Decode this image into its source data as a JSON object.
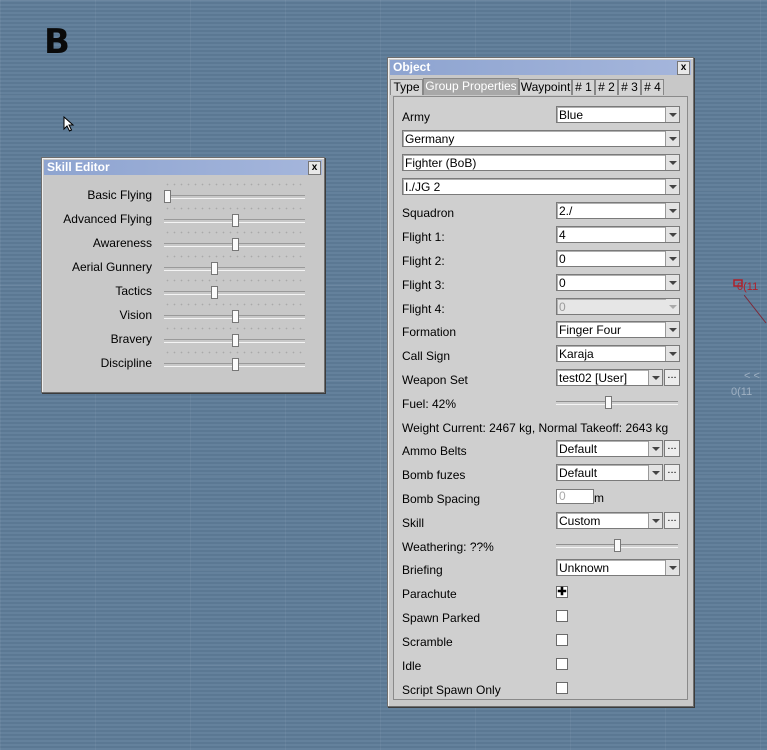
{
  "panel_letter": "B",
  "map": {
    "marker_red": "0(11",
    "marker_faint_1": "< <",
    "marker_faint_2": "0(11"
  },
  "skill_editor": {
    "title": "Skill Editor",
    "close_label": "x",
    "skills": [
      {
        "label": "Basic Flying",
        "level": 0.0
      },
      {
        "label": "Advanced Flying",
        "level": 0.5
      },
      {
        "label": "Awareness",
        "level": 0.5
      },
      {
        "label": "Aerial Gunnery",
        "level": 0.35
      },
      {
        "label": "Tactics",
        "level": 0.35
      },
      {
        "label": "Vision",
        "level": 0.5
      },
      {
        "label": "Bravery",
        "level": 0.5
      },
      {
        "label": "Discipline",
        "level": 0.5
      }
    ]
  },
  "object_window": {
    "title": "Object",
    "close_label": "x",
    "tabs": [
      "Type",
      "Group Properties",
      "Waypoint",
      "# 1",
      "# 2",
      "# 3",
      "# 4"
    ],
    "active_tab": "Group Properties",
    "fields": {
      "army": {
        "label": "Army",
        "value": "Blue"
      },
      "country": {
        "value": "Germany"
      },
      "aircraft_class": {
        "value": "Fighter (BoB)"
      },
      "unit": {
        "value": "I./JG 2"
      },
      "squadron": {
        "label": "Squadron",
        "value": "2./"
      },
      "flight1": {
        "label": "Flight 1:",
        "value": "4"
      },
      "flight2": {
        "label": "Flight 2:",
        "value": "0"
      },
      "flight3": {
        "label": "Flight 3:",
        "value": "0"
      },
      "flight4": {
        "label": "Flight 4:",
        "value": "0"
      },
      "formation": {
        "label": "Formation",
        "value": "Finger Four"
      },
      "call_sign": {
        "label": "Call Sign",
        "value": "Karaja"
      },
      "weapon_set": {
        "label": "Weapon Set",
        "value": "test02 [User]"
      },
      "fuel": {
        "label": "Fuel: 42%",
        "level": 0.42
      },
      "weight": {
        "label": "Weight  Current: 2467 kg, Normal Takeoff: 2643 kg"
      },
      "ammo_belts": {
        "label": "Ammo Belts",
        "value": "Default"
      },
      "bomb_fuzes": {
        "label": "Bomb fuzes",
        "value": "Default"
      },
      "bomb_spacing": {
        "label": "Bomb Spacing",
        "value": "0",
        "unit": "m"
      },
      "skill": {
        "label": "Skill",
        "value": "Custom"
      },
      "weathering": {
        "label": "Weathering: ??%",
        "level": 0.5
      },
      "briefing": {
        "label": "Briefing",
        "value": "Unknown"
      },
      "parachute": {
        "label": "Parachute",
        "checked": true
      },
      "spawn_parked": {
        "label": "Spawn Parked",
        "checked": false
      },
      "scramble": {
        "label": "Scramble",
        "checked": false
      },
      "idle": {
        "label": "Idle",
        "checked": false
      },
      "script_spawn_only": {
        "label": "Script Spawn Only",
        "checked": false
      }
    },
    "more_button_label": "..."
  }
}
